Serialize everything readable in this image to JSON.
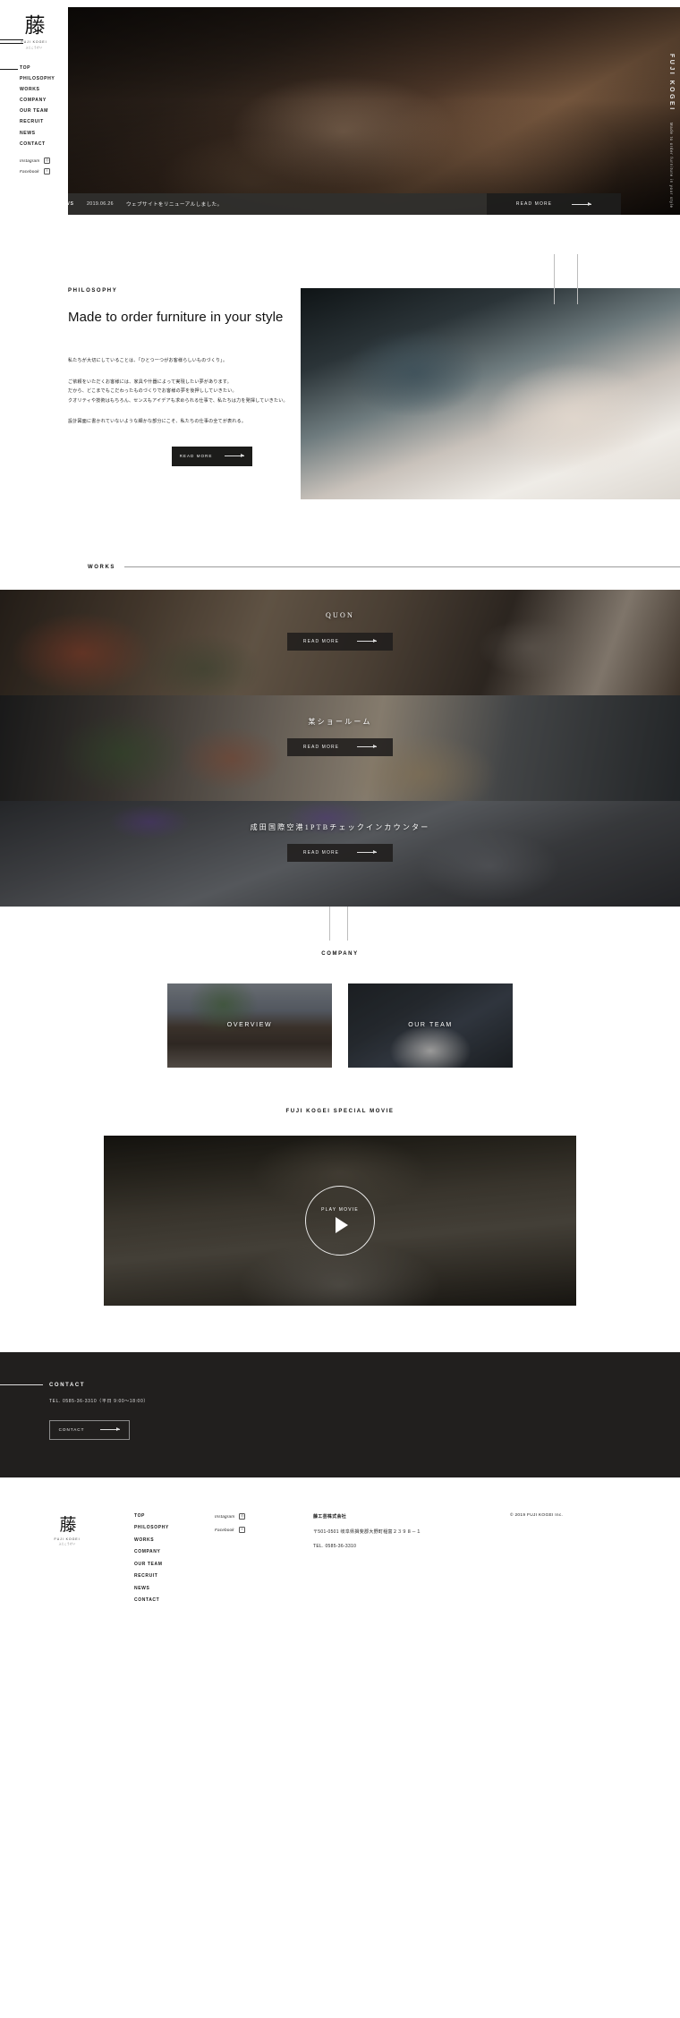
{
  "brand": {
    "logo_mark": "藤",
    "logo_sub": "FUJI KOGEI",
    "logo_sub2": "ふじこうげい",
    "vertical_title": "FUJI KOGEI",
    "vertical_sub": "Made to order furniture in your style"
  },
  "nav": {
    "items": [
      {
        "label": "TOP"
      },
      {
        "label": "PHILOSOPHY"
      },
      {
        "label": "WORKS"
      },
      {
        "label": "COMPANY"
      },
      {
        "label": "OUR TEAM"
      },
      {
        "label": "RECRUIT"
      },
      {
        "label": "NEWS"
      },
      {
        "label": "CONTACT"
      }
    ]
  },
  "social": [
    {
      "label": "Instagram",
      "icon": "instagram-icon",
      "glyph": "◎"
    },
    {
      "label": "Facebook",
      "icon": "facebook-icon",
      "glyph": "f"
    }
  ],
  "newsbar": {
    "tag": "NEWS",
    "date": "2019.06.26",
    "text": "ウェブサイトをリニューアルしました。",
    "read_more": "READ MORE"
  },
  "philosophy": {
    "label": "PHILOSOPHY",
    "title": "Made to order furniture in your style",
    "paragraphs": [
      "私たちが大切にしていることは、「ひとつ一つがお客様らしいものづくり」。",
      "ご依頼をいただくお客様には、家具や什器によって実現したい夢があります。\nだから、どこまでもこだわったものづくりでお客様の夢を後押ししていきたい。\nクオリティや技術はもちろん、センスもアイデアも求められる仕事で、私たちは力を発揮していきたい。",
      "設計図面に書かれていないような細かな部分にこそ、私たちの仕事の全てが表れる。"
    ],
    "read_more": "READ MORE"
  },
  "works": {
    "label": "WORKS",
    "items": [
      {
        "title": "QUON",
        "read_more": "READ MORE"
      },
      {
        "title": "某ショールーム",
        "read_more": "READ MORE"
      },
      {
        "title": "成田国際空港1PTBチェックインカウンター",
        "read_more": "READ MORE"
      }
    ]
  },
  "company": {
    "label": "COMPANY",
    "cards": [
      {
        "label": "OVERVIEW"
      },
      {
        "label": "OUR TEAM"
      }
    ]
  },
  "movie": {
    "heading": "FUJI KOGEI SPECIAL MOVIE",
    "play_label": "PLAY MOVIE"
  },
  "contact": {
    "label": "CONTACT",
    "tel": "TEL. 0585-36-3310（平日 9:00〜18:00）",
    "button": "CONTACT"
  },
  "footer": {
    "nav": [
      {
        "label": "TOP"
      },
      {
        "label": "PHILOSOPHY"
      },
      {
        "label": "WORKS"
      },
      {
        "label": "COMPANY"
      },
      {
        "label": "OUR TEAM"
      },
      {
        "label": "RECRUIT"
      },
      {
        "label": "NEWS"
      },
      {
        "label": "CONTACT"
      }
    ],
    "social": [
      {
        "label": "Instagram",
        "glyph": "◎"
      },
      {
        "label": "Facebook",
        "glyph": "f"
      }
    ],
    "company_name": "藤工芸株式会社",
    "address": "〒501-0501 岐阜県揖斐郡大野町稲富２３９８－１",
    "tel": "TEL. 0585-36-3310",
    "copyright": "© 2019 FUJI KOGEI Inc."
  },
  "colors": {
    "dark": "#211f1e",
    "text": "#1a1a1a",
    "rule": "#9b9b9b"
  }
}
